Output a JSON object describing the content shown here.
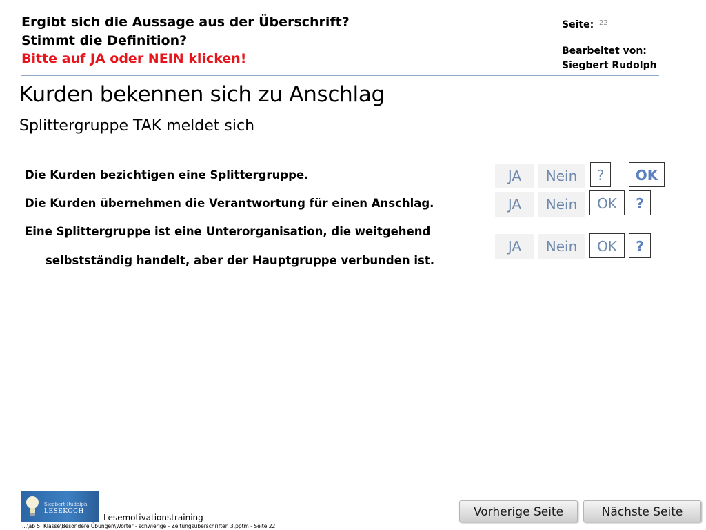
{
  "header": {
    "line1": "Ergibt sich die Aussage aus der Überschrift?",
    "line2": "Stimmt die Definition?",
    "line3": "Bitte auf JA oder NEIN klicken!",
    "page_label": "Seite:",
    "page_number": "22",
    "edited_by_label": "Bearbeitet von:",
    "editor_name": "Siegbert Rudolph"
  },
  "headline": "Kurden bekennen sich zu Anschlag",
  "subheadline": "Splittergruppe TAK meldet sich",
  "statements": [
    "Die Kurden bezichtigen eine Splittergruppe.",
    "Die Kurden übernehmen die Verantwortung für einen Anschlag.",
    "Eine Splittergruppe ist eine Unterorganisation, die weitgehend",
    "selbstständig handelt, aber der Hauptgruppe verbunden ist."
  ],
  "answer_rows": [
    {
      "yes": "JA",
      "no": "Nein",
      "q": "?",
      "ok": "OK"
    },
    {
      "yes": "JA",
      "no": "Nein",
      "ok": "OK",
      "q": "?"
    },
    {
      "yes": "JA",
      "no": "Nein",
      "ok": "OK",
      "q": "?"
    }
  ],
  "footer": {
    "logo_small": "Siegbert Rudolph",
    "logo_big": "LESEKOCH",
    "brand": "Lesemotivationstraining",
    "path": "...\\ab 5. Klasse\\Besondere Übungen\\Wörter - schwierige - Zeitungsüberschriften 3.pptm - Seite 22"
  },
  "nav": {
    "prev_label": "Vorherige Seite",
    "next_label": "Nächste Seite"
  },
  "colors": {
    "accent_red": "#e8141b",
    "button_text": "#6f89ad",
    "question_blue": "#5b7fbf",
    "rule": "#8fa9c9"
  }
}
